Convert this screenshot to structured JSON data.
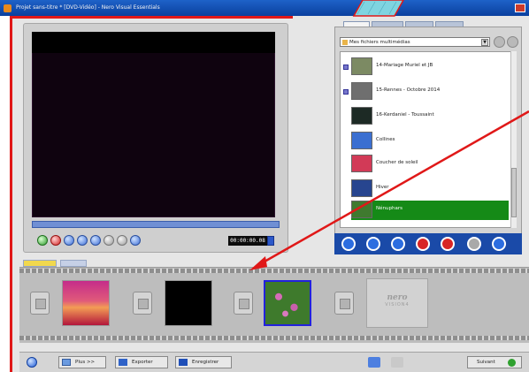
{
  "window": {
    "title": "Projet sans-titre * [DVD-Vidéo] - Nero Visual Essentials"
  },
  "preview": {
    "timecode": "00:00:00.08"
  },
  "browser": {
    "tabs": [
      "",
      "",
      "",
      ""
    ],
    "source_select": "Mes fichiers multimédias",
    "items": [
      {
        "label": "14-Mariage Muriel et JB",
        "thumb": "#7c8a63",
        "expand": true
      },
      {
        "label": "15-Rennes - Octobre 2014",
        "thumb": "#6f6f6f",
        "expand": true
      },
      {
        "label": "16-Kerdaniel - Toussaint",
        "thumb": "#1d2a25",
        "expand": false
      },
      {
        "label": "Collines",
        "thumb": "#3b6fd1",
        "expand": false
      },
      {
        "label": "Coucher de soleil",
        "thumb": "#d23a57",
        "expand": false
      },
      {
        "label": "Hiver",
        "thumb": "#27458f",
        "expand": false
      },
      {
        "label": "Nénuphars",
        "thumb": "#3f7a2f",
        "expand": false
      }
    ],
    "selected_index": 6
  },
  "timeline": {
    "tabs": [
      "",
      ""
    ],
    "clips": [
      {
        "kind": "sunset",
        "color": "#d9314f"
      },
      {
        "kind": "black",
        "color": "#000000"
      },
      {
        "kind": "water-lilies",
        "color": "#3a6f2a"
      }
    ],
    "placeholder_logo": {
      "line1": "nero",
      "line2": "VISION4"
    }
  },
  "bottombar": {
    "more_label": "Plus >>",
    "export_label": "Exporter",
    "save_label": "Enregistrer",
    "next_label": "Suivant"
  },
  "colors": {
    "annotation_red": "#e01818",
    "selection_green": "#158a17",
    "action_bar_blue": "#1a4aa8"
  },
  "icons": {
    "help": "help-icon",
    "more": "photo-icon",
    "export": "export-icon",
    "save": "floppy-icon",
    "next": "next-arrow-icon"
  }
}
